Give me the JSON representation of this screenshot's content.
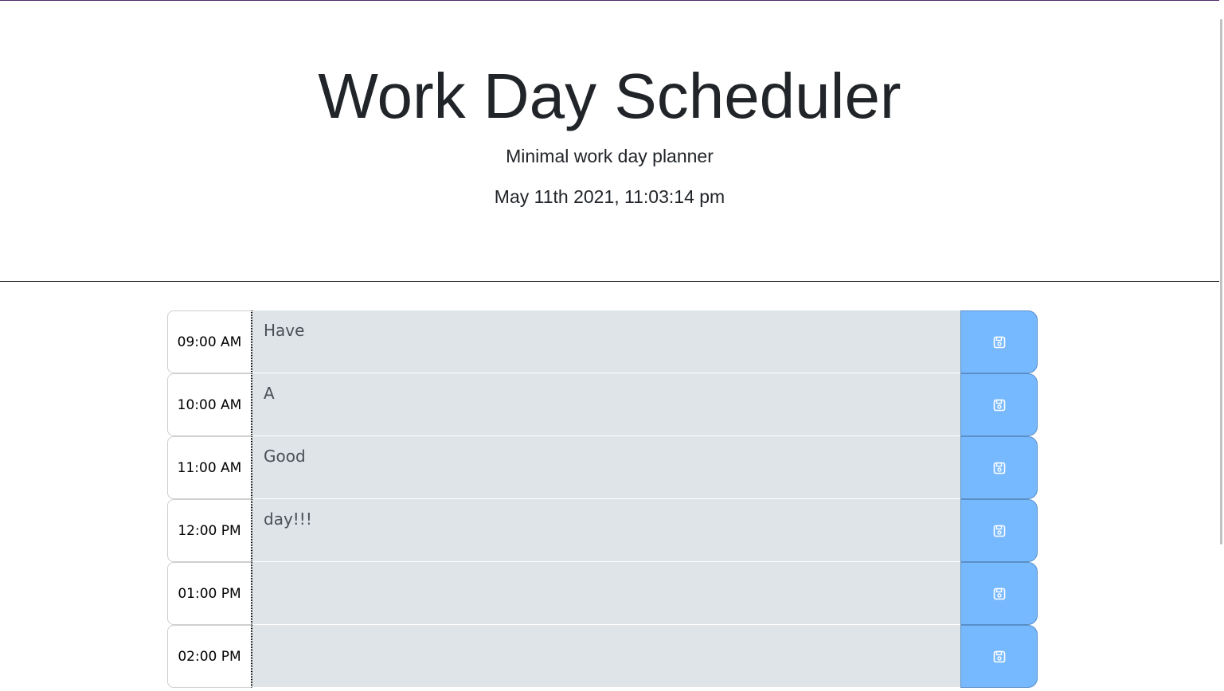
{
  "header": {
    "title": "Work Day Scheduler",
    "lead": "Minimal work day planner",
    "current_day": "May 11th 2021, 11:03:14 pm"
  },
  "schedule": {
    "blocks": [
      {
        "hour": "09:00 AM",
        "text": "Have"
      },
      {
        "hour": "10:00 AM",
        "text": "A"
      },
      {
        "hour": "11:00 AM",
        "text": "Good"
      },
      {
        "hour": "12:00 PM",
        "text": "day!!!"
      },
      {
        "hour": "01:00 PM",
        "text": ""
      },
      {
        "hour": "02:00 PM",
        "text": ""
      }
    ],
    "save_icon": "save-icon"
  },
  "colors": {
    "description_bg": "#dee4e7",
    "save_button_bg": "#77b9ff",
    "top_line": "#4b2a6b"
  }
}
